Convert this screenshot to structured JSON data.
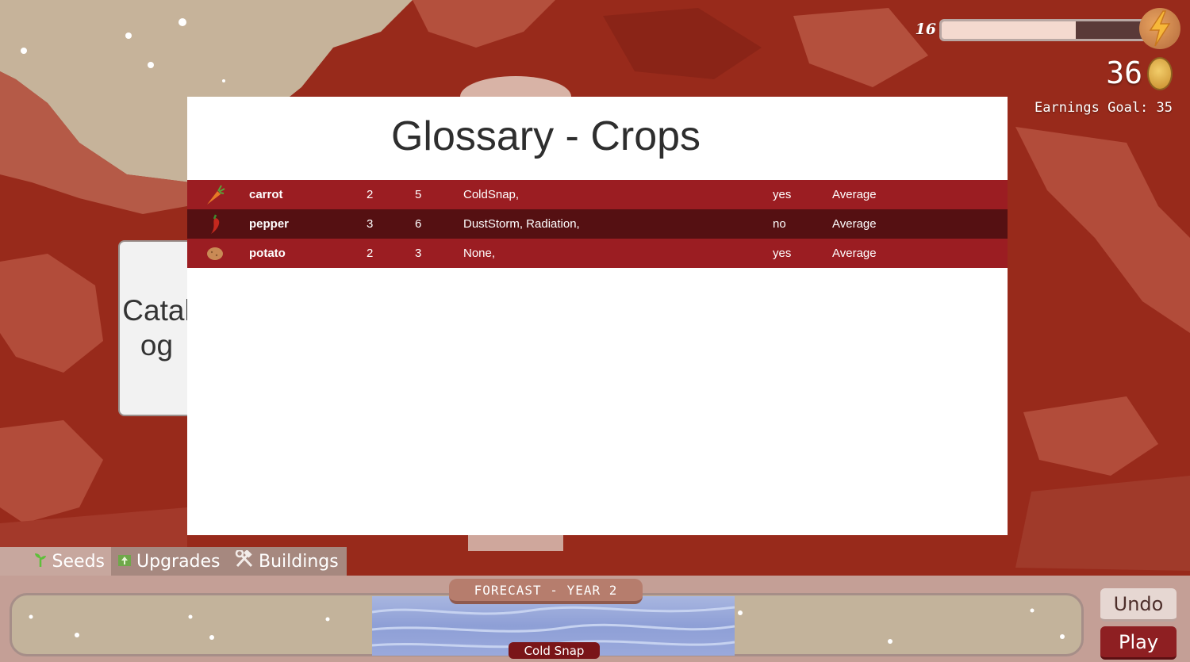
{
  "hud": {
    "energy_value": "16",
    "energy_fraction": 0.64,
    "coins": "36",
    "earnings_goal": "Earnings Goal: 35",
    "colors": {
      "energy_fill": "#f4d9cf",
      "energy_empty": "#5a3a38"
    }
  },
  "catalog_tab": {
    "label": "Catalog"
  },
  "glossary": {
    "title": "Glossary - Crops",
    "rows": [
      {
        "icon": "carrot-icon",
        "name": "carrot",
        "a": "2",
        "b": "5",
        "weather": "ColdSnap,",
        "flag": "yes",
        "quality": "Average"
      },
      {
        "icon": "pepper-icon",
        "name": "pepper",
        "a": "3",
        "b": "6",
        "weather": "DustStorm, Radiation,",
        "flag": "no",
        "quality": "Average"
      },
      {
        "icon": "potato-icon",
        "name": "potato",
        "a": "2",
        "b": "3",
        "weather": "None,",
        "flag": "yes",
        "quality": "Average"
      }
    ]
  },
  "tabs": {
    "seeds": "Seeds",
    "upgrades": "Upgrades",
    "buildings": "Buildings"
  },
  "forecast": {
    "banner": "FORECAST - YEAR 2",
    "event": "Cold Snap"
  },
  "buttons": {
    "undo": "Undo",
    "play": "Play"
  }
}
